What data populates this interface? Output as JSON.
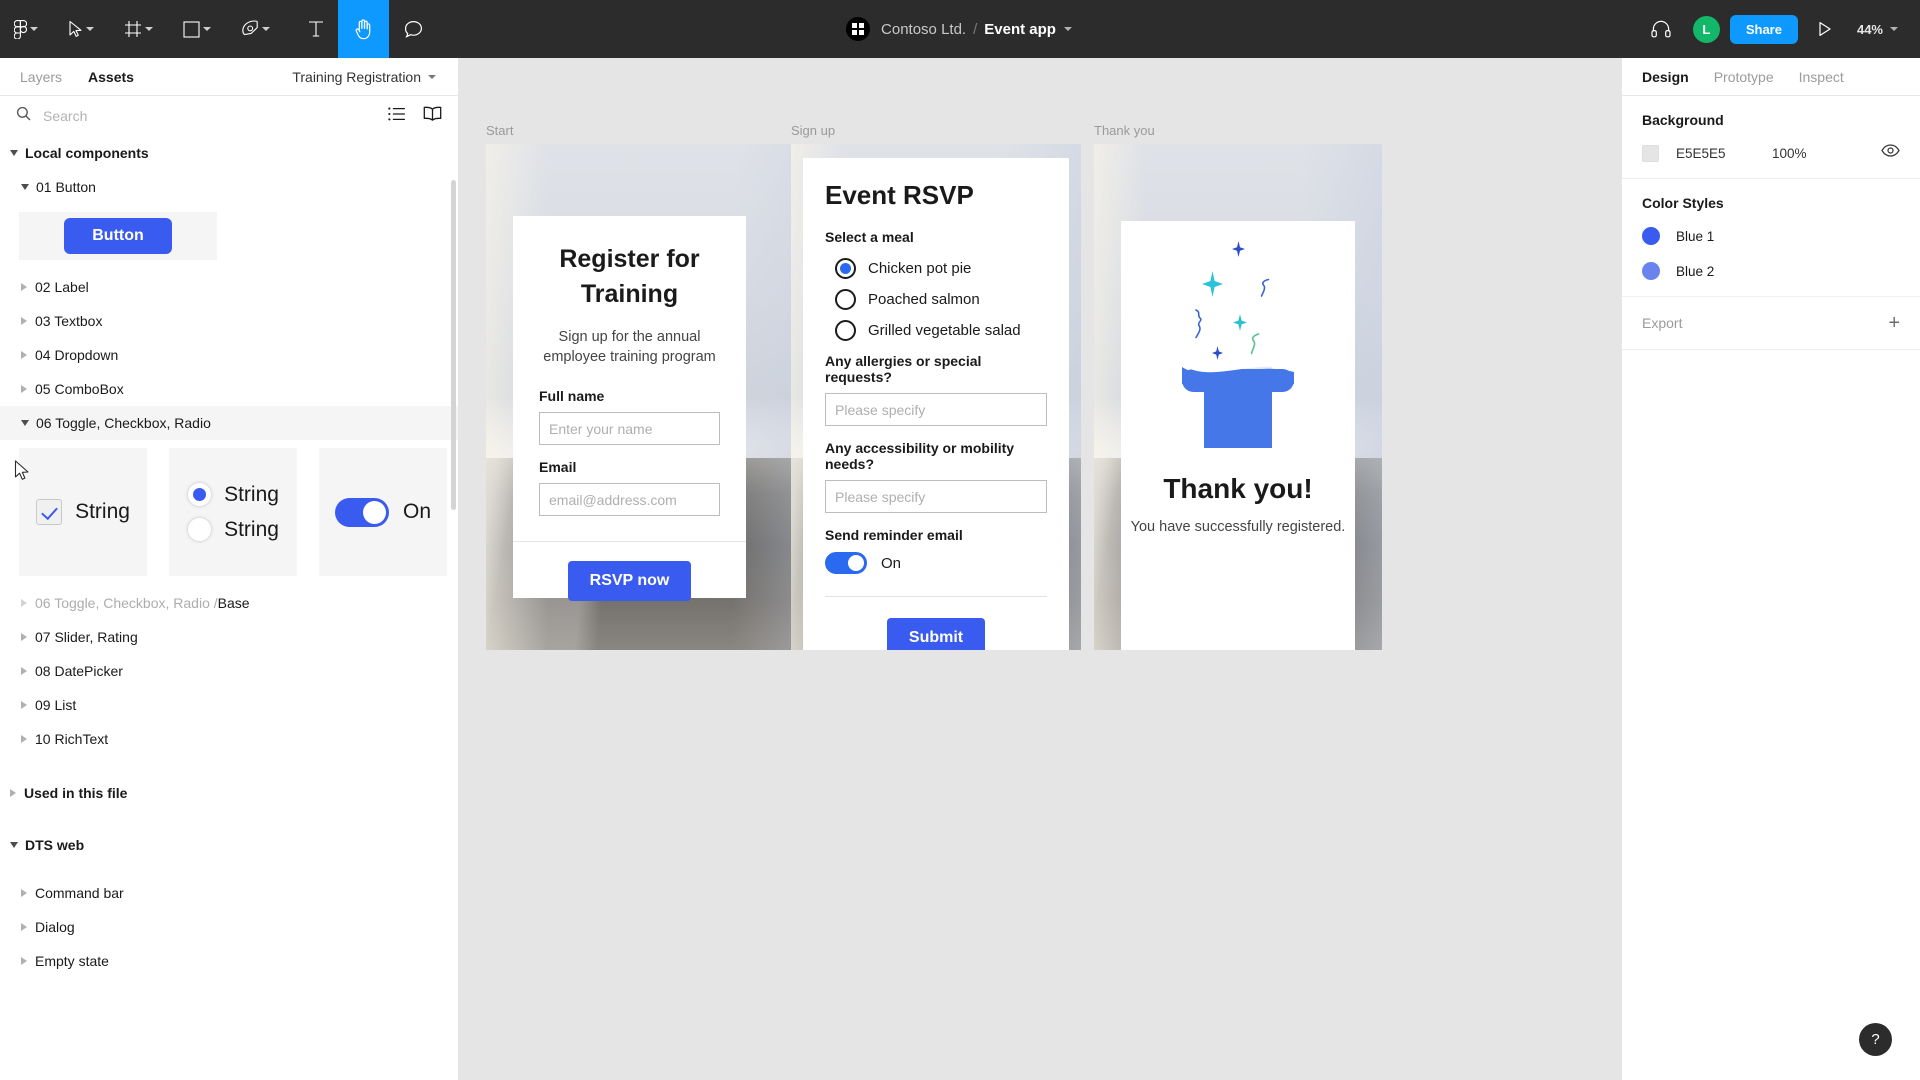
{
  "topbar": {
    "tools": [
      {
        "name": "figma-logo-icon",
        "caret": true
      },
      {
        "name": "move-tool-icon",
        "caret": true
      },
      {
        "name": "frame-tool-icon",
        "caret": true
      },
      {
        "name": "shape-tool-icon",
        "caret": true
      },
      {
        "name": "pen-tool-icon",
        "caret": true
      },
      {
        "name": "text-tool-icon",
        "caret": false
      },
      {
        "name": "hand-tool-icon",
        "caret": false,
        "active": true
      },
      {
        "name": "comment-tool-icon",
        "caret": false
      }
    ],
    "org": "Contoso Ltd.",
    "separator": "/",
    "file": "Event app",
    "avatar_initial": "L",
    "share_label": "Share",
    "zoom": "44%"
  },
  "left_panel": {
    "tabs": [
      {
        "label": "Layers",
        "selected": false
      },
      {
        "label": "Assets",
        "selected": true
      }
    ],
    "library": "Training Registration",
    "search_placeholder": "Search",
    "search_value": "",
    "groups": [
      {
        "label": "Local components",
        "open": true,
        "bold": true
      },
      {
        "label": "01 Button",
        "open": true,
        "indent": 1
      },
      {
        "label": "02 Label",
        "open": false,
        "indent": 1
      },
      {
        "label": "03 Textbox",
        "open": false,
        "indent": 1
      },
      {
        "label": "04 Dropdown",
        "open": false,
        "indent": 1
      },
      {
        "label": "05 ComboBox",
        "open": false,
        "indent": 1
      },
      {
        "label": "06 Toggle, Checkbox, Radio",
        "open": true,
        "indent": 1,
        "selected": true
      },
      {
        "label": "06 Toggle, Checkbox, Radio / ",
        "tail": "Base",
        "open": false,
        "indent": 1,
        "muted": true
      },
      {
        "label": "07 Slider, Rating",
        "open": false,
        "indent": 1
      },
      {
        "label": "08 DatePicker",
        "open": false,
        "indent": 1
      },
      {
        "label": "09 List",
        "open": false,
        "indent": 1
      },
      {
        "label": "10 RichText",
        "open": false,
        "indent": 1
      },
      {
        "label": "Used in this file",
        "open": false,
        "bold": true
      },
      {
        "label": "DTS web",
        "open": true,
        "bold": true
      },
      {
        "label": "Command bar",
        "open": false,
        "indent": 1
      },
      {
        "label": "Dialog",
        "open": false,
        "indent": 1
      },
      {
        "label": "Empty state",
        "open": false,
        "indent": 1
      }
    ],
    "button_sample_label": "Button",
    "checkbox_sample_label": "String",
    "radio_sample_label_1": "String",
    "radio_sample_label_2": "String",
    "toggle_sample_label": "On"
  },
  "canvas": {
    "frames": [
      {
        "name": "Start",
        "title": "Register for Training",
        "subtitle": "Sign up for the annual employee training program",
        "fields": [
          {
            "label": "Full name",
            "placeholder": "Enter your name",
            "value": ""
          },
          {
            "label": "Email",
            "placeholder": "email@address.com",
            "value": ""
          }
        ],
        "button": "RSVP now"
      },
      {
        "name": "Sign up",
        "title": "Event RSVP",
        "meal_label": "Select a meal",
        "meals": [
          {
            "label": "Chicken pot pie",
            "selected": true
          },
          {
            "label": "Poached salmon",
            "selected": false
          },
          {
            "label": "Grilled vegetable salad",
            "selected": false
          }
        ],
        "questions": [
          {
            "label": "Any allergies or special requests?",
            "placeholder": "Please specify",
            "value": ""
          },
          {
            "label": "Any accessibility or mobility needs?",
            "placeholder": "Please specify",
            "value": ""
          }
        ],
        "reminder_label": "Send reminder email",
        "reminder_state": "On",
        "button": "Submit"
      },
      {
        "name": "Thank you",
        "title": "Thank you!",
        "subtitle": "You have successfully registered."
      }
    ]
  },
  "right_panel": {
    "tabs": [
      {
        "label": "Design",
        "selected": true
      },
      {
        "label": "Prototype",
        "selected": false
      },
      {
        "label": "Inspect",
        "selected": false
      }
    ],
    "background": {
      "title": "Background",
      "hex": "E5E5E5",
      "opacity": "100%",
      "swatch": "#E5E5E5"
    },
    "color_styles": {
      "title": "Color Styles",
      "items": [
        {
          "label": "Blue 1",
          "color": "#3A5BF0"
        },
        {
          "label": "Blue 2",
          "color": "#6A83EE"
        }
      ]
    },
    "export": {
      "label": "Export",
      "add": "+"
    }
  },
  "help_button": "?"
}
